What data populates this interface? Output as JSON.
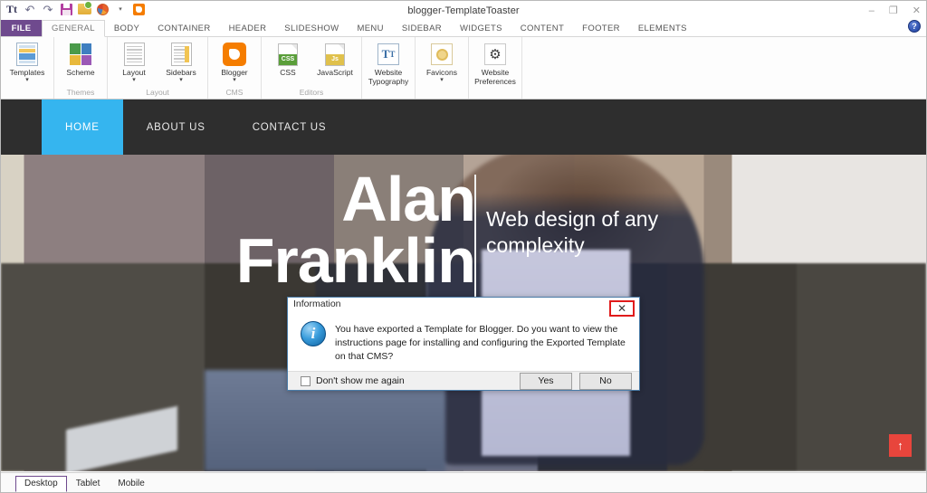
{
  "window": {
    "title": "blogger-TemplateToaster",
    "controls": {
      "minimize": "–",
      "maximize": "❐",
      "close": "✕",
      "help": "?"
    }
  },
  "quick_access": [
    {
      "name": "typography-icon",
      "label": "Tt"
    },
    {
      "name": "undo-icon",
      "label": "↶"
    },
    {
      "name": "redo-icon",
      "label": "↷"
    },
    {
      "name": "save-icon",
      "label": ""
    },
    {
      "name": "export-icon",
      "label": ""
    },
    {
      "name": "preview-browser-icon",
      "label": ""
    },
    {
      "name": "browser-dropdown-icon",
      "label": "▾"
    },
    {
      "name": "blogger-icon",
      "label": ""
    }
  ],
  "ribbon": {
    "file_tab": "FILE",
    "tabs": [
      {
        "label": "GENERAL",
        "active": true
      },
      {
        "label": "BODY",
        "active": false
      },
      {
        "label": "CONTAINER",
        "active": false
      },
      {
        "label": "HEADER",
        "active": false
      },
      {
        "label": "SLIDESHOW",
        "active": false
      },
      {
        "label": "MENU",
        "active": false
      },
      {
        "label": "SIDEBAR",
        "active": false
      },
      {
        "label": "WIDGETS",
        "active": false
      },
      {
        "label": "CONTENT",
        "active": false
      },
      {
        "label": "FOOTER",
        "active": false
      },
      {
        "label": "ELEMENTS",
        "active": false
      }
    ],
    "groups": [
      {
        "title": "",
        "items": [
          {
            "label": "Templates",
            "icon": "templates-icon",
            "dropdown": true
          }
        ]
      },
      {
        "title": "Themes",
        "items": [
          {
            "label": "Scheme",
            "icon": "scheme-icon",
            "dropdown": false
          }
        ]
      },
      {
        "title": "Layout",
        "items": [
          {
            "label": "Layout",
            "icon": "layout-icon",
            "dropdown": true
          },
          {
            "label": "Sidebars",
            "icon": "sidebars-icon",
            "dropdown": true
          }
        ]
      },
      {
        "title": "CMS",
        "items": [
          {
            "label": "Blogger",
            "icon": "blogger-icon",
            "dropdown": true
          }
        ]
      },
      {
        "title": "Editors",
        "items": [
          {
            "label": "CSS",
            "icon": "css-file-icon",
            "dropdown": false
          },
          {
            "label": "JavaScript",
            "icon": "javascript-file-icon",
            "dropdown": false
          }
        ]
      },
      {
        "title": "",
        "items": [
          {
            "label": "Website Typography",
            "icon": "website-typography-icon",
            "dropdown": false
          }
        ]
      },
      {
        "title": "",
        "items": [
          {
            "label": "Favicons",
            "icon": "favicons-icon",
            "dropdown": true
          }
        ]
      },
      {
        "title": "",
        "items": [
          {
            "label": "Website Preferences",
            "icon": "website-preferences-icon",
            "dropdown": false
          }
        ]
      }
    ]
  },
  "website": {
    "menu": [
      {
        "label": "HOME",
        "active": true
      },
      {
        "label": "ABOUT US",
        "active": false
      },
      {
        "label": "CONTACT US",
        "active": false
      }
    ],
    "hero": {
      "name": "Alan Franklin",
      "tagline": "Web design of any complexity"
    },
    "scroll_top_icon": "↑"
  },
  "dialog": {
    "title": "Information",
    "close_label": "✕",
    "message": "You have exported a Template for Blogger. Do you want to view the instructions page for installing and configuring the Exported Template on that CMS?",
    "checkbox_label": "Don't show me again",
    "buttons": [
      {
        "label": "Yes"
      },
      {
        "label": "No"
      }
    ]
  },
  "statusbar": {
    "views": [
      {
        "label": "Desktop",
        "active": true
      },
      {
        "label": "Tablet",
        "active": false
      },
      {
        "label": "Mobile",
        "active": false
      }
    ]
  },
  "colors": {
    "accent_purple": "#6f4a8e",
    "menu_active_blue": "#35b5ef",
    "scroll_top_red": "#e8453c",
    "highlight_red": "#e01b1b"
  }
}
